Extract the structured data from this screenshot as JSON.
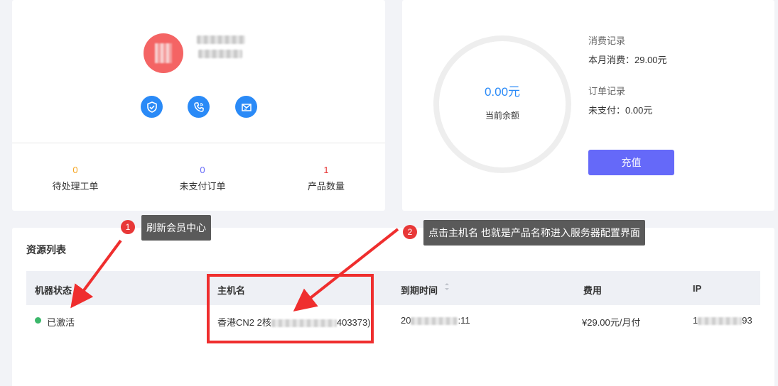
{
  "colors": {
    "accent": "#2a8af7",
    "button": "#6569f9",
    "annotation": "#e83838",
    "active": "#3bb76a"
  },
  "profile": {
    "icons": [
      "shield-check-icon",
      "phone-icon",
      "mail-icon"
    ],
    "stats": [
      {
        "value": "0",
        "label": "待处理工单",
        "color": "#f5a623"
      },
      {
        "value": "0",
        "label": "未支付订单",
        "color": "#6569f9"
      },
      {
        "value": "1",
        "label": "产品数量",
        "color": "#e83838"
      }
    ]
  },
  "balance": {
    "amount": "0.00元",
    "label": "当前余额",
    "consumption_title": "消费记录",
    "consumption_value": "本月消费：29.00元",
    "order_title": "订单记录",
    "order_value": "未支付：0.00元",
    "recharge_label": "充值"
  },
  "resources": {
    "title": "资源列表",
    "columns": [
      "机器状态",
      "主机名",
      "到期时间",
      "费用",
      "IP"
    ],
    "row": {
      "status": "已激活",
      "hostname_prefix": "香港CN2 2核",
      "hostname_suffix": "403373)",
      "expiry_prefix": "20",
      "expiry_suffix": ":11",
      "fee": "¥29.00元/月付",
      "ip_prefix": "1",
      "ip_suffix": "93"
    }
  },
  "annotations": [
    {
      "number": "1",
      "text": "刷新会员中心"
    },
    {
      "number": "2",
      "text": "点击主机名 也就是产品名称进入服务器配置界面"
    }
  ]
}
